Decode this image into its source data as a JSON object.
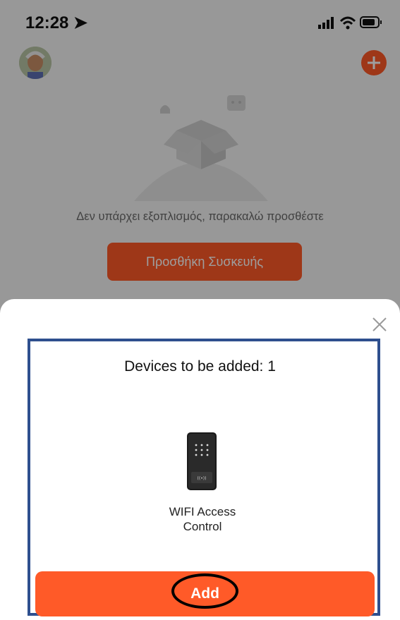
{
  "status_bar": {
    "time": "12:28 ➤",
    "icons": [
      "signal-icon",
      "wifi-icon",
      "battery-icon"
    ]
  },
  "background_screen": {
    "empty_message": "Δεν υπάρχει εξοπλισμός, παρακαλώ προσθέστε",
    "add_device_label": "Προσθήκη Συσκευής"
  },
  "sheet": {
    "title": "Devices to be added: 1",
    "device": {
      "name_line1": "WIFI Access",
      "name_line2": "Control",
      "icon": "access-control-device-icon"
    },
    "add_label": "Add",
    "close_icon": "close-icon"
  },
  "colors": {
    "accent": "#ff5a28",
    "highlight_border": "#2e4f8e"
  }
}
